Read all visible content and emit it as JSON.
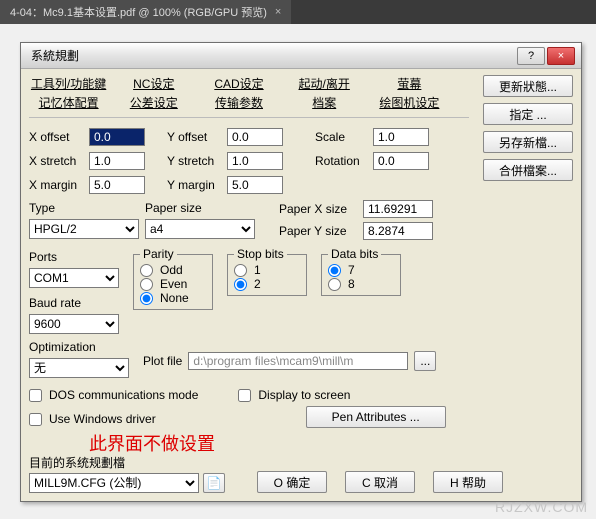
{
  "outer_tab": {
    "label": "4-04：Mc9.1基本设置.pdf @ 100% (RGB/GPU 预览)",
    "close_glyph": "×"
  },
  "dialog": {
    "title": "系統規劃",
    "help_glyph": "?",
    "close_glyph": "×",
    "navlinks_row1": [
      "工具列/功能鍵",
      "NC设定",
      "CAD设定",
      "起动/离开",
      "萤幕"
    ],
    "navlinks_row2": [
      "记忆体配置",
      "公差设定",
      "传输参数",
      "档案",
      "绘图机设定"
    ],
    "right_buttons": [
      "更新狀態...",
      "指定 ...",
      "另存新檔...",
      "合併檔案..."
    ],
    "params": {
      "x_offset": {
        "label": "X offset",
        "value": "0.0"
      },
      "y_offset": {
        "label": "Y offset",
        "value": "0.0"
      },
      "scale": {
        "label": "Scale",
        "value": "1.0"
      },
      "x_stretch": {
        "label": "X stretch",
        "value": "1.0"
      },
      "y_stretch": {
        "label": "Y stretch",
        "value": "1.0"
      },
      "rotation": {
        "label": "Rotation",
        "value": "0.0"
      },
      "x_margin": {
        "label": "X margin",
        "value": "5.0"
      },
      "y_margin": {
        "label": "Y margin",
        "value": "5.0"
      }
    },
    "type": {
      "label": "Type",
      "value": "HPGL/2"
    },
    "paper_size": {
      "label": "Paper size",
      "value": "a4"
    },
    "paper_x": {
      "label": "Paper X size",
      "value": "11.69291"
    },
    "paper_y": {
      "label": "Paper Y size",
      "value": "8.2874"
    },
    "ports": {
      "label": "Ports",
      "value": "COM1"
    },
    "baud": {
      "label": "Baud rate",
      "value": "9600"
    },
    "parity": {
      "legend": "Parity",
      "opts": [
        "Odd",
        "Even",
        "None"
      ],
      "selected": "None"
    },
    "stopbits": {
      "legend": "Stop bits",
      "opts": [
        "1",
        "2"
      ],
      "selected": "2"
    },
    "databits": {
      "legend": "Data bits",
      "opts": [
        "7",
        "8"
      ],
      "selected": "7"
    },
    "optimization": {
      "label": "Optimization",
      "value": "无"
    },
    "plot_file": {
      "label": "Plot file",
      "value": "d:\\program files\\mcam9\\mill\\m"
    },
    "browse_glyph": "...",
    "dos_mode": {
      "label": "DOS communications mode",
      "checked": false
    },
    "display_screen": {
      "label": "Display to screen",
      "checked": false
    },
    "use_win_driver": {
      "label": "Use Windows driver",
      "checked": false
    },
    "pen_attr": {
      "label": "Pen Attributes ..."
    },
    "red_note": "此界面不做设置",
    "current_file": {
      "label": "目前的系统规劃檔",
      "value": "MILL9M.CFG (公制)"
    },
    "file_icon_glyph": "📄",
    "ok": {
      "label": "O 确定"
    },
    "cancel": {
      "label": "C 取消"
    },
    "help": {
      "label": "H 帮助"
    }
  },
  "watermark": "RJZXW.COM"
}
